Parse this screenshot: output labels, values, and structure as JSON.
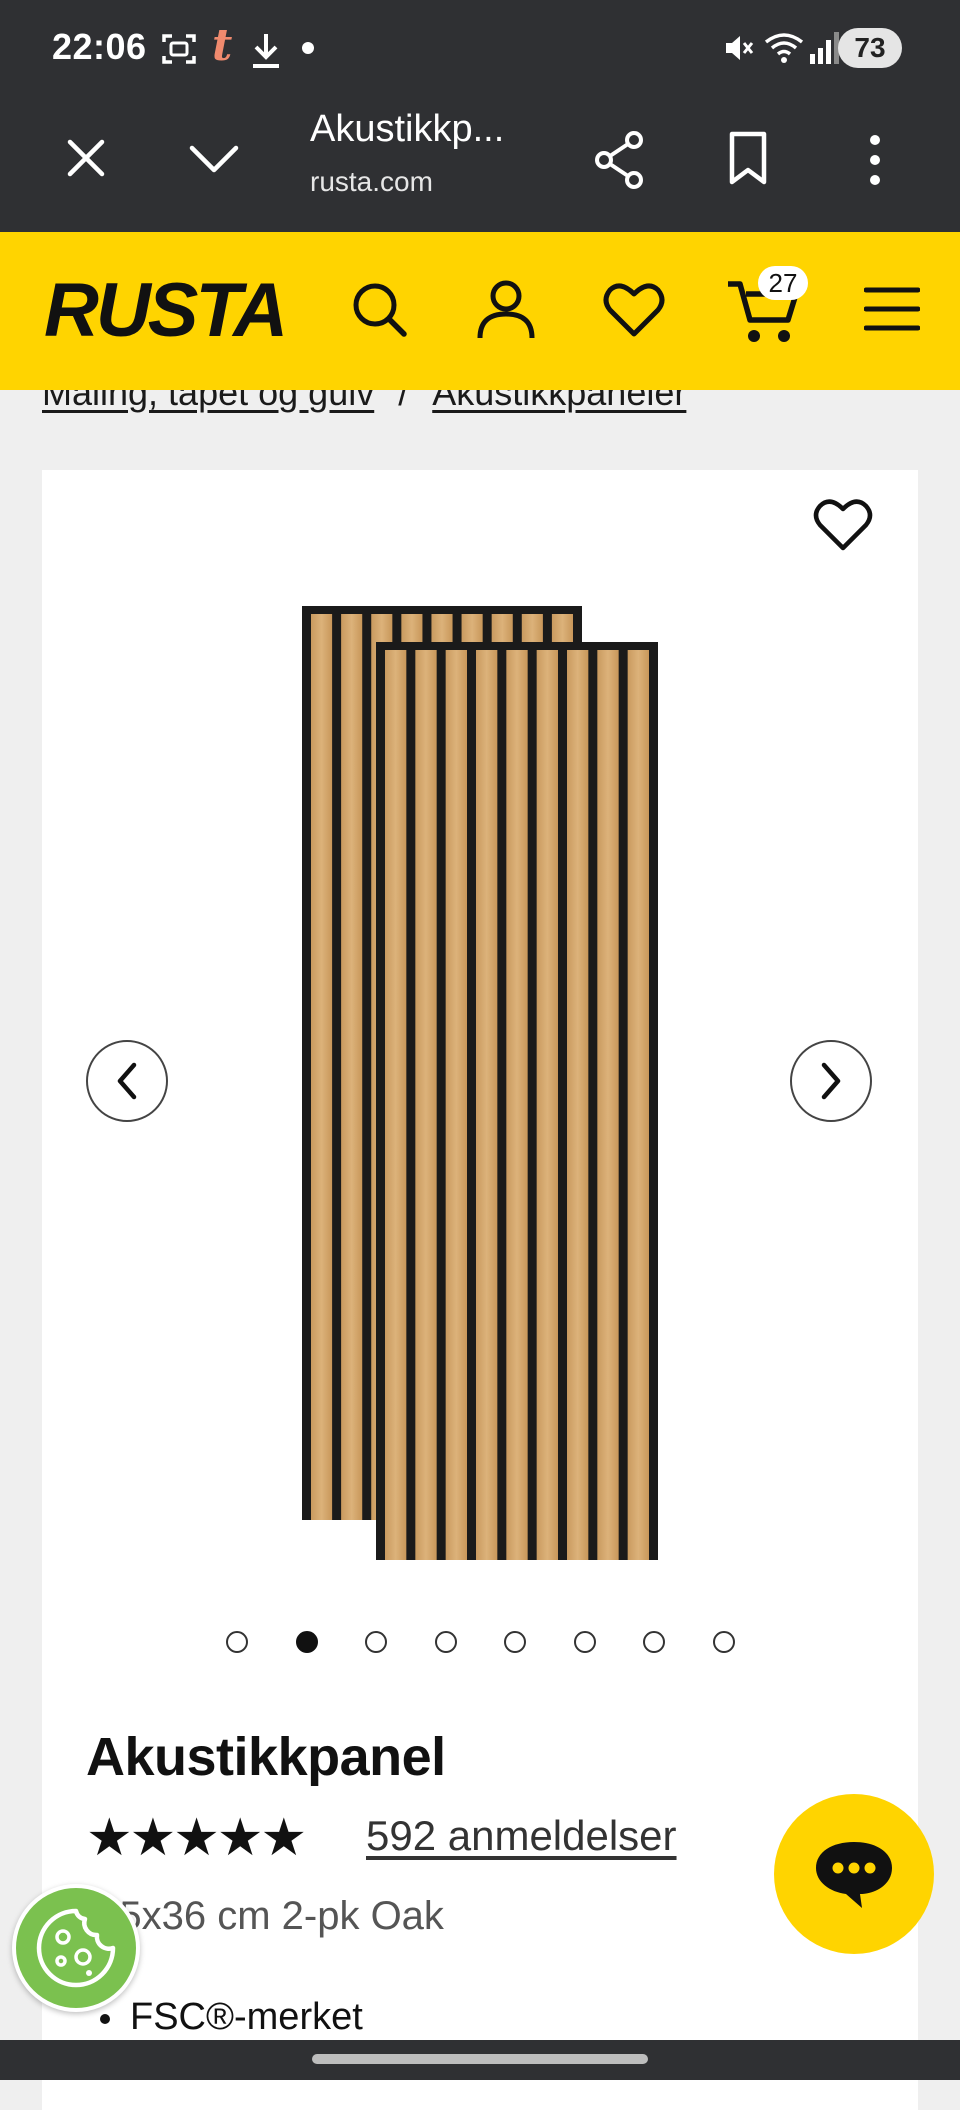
{
  "status_bar": {
    "time": "22:06",
    "battery": "73"
  },
  "browser": {
    "tab_title": "Akustikkp...",
    "url": "rusta.com"
  },
  "site": {
    "brand": "RUSTA",
    "cart_count": "27",
    "accent": "#ffd400"
  },
  "breadcrumb": {
    "items": [
      "Maling, tapet og gulv",
      "Akustikkpaneler"
    ],
    "separator": "/"
  },
  "gallery": {
    "image_count": 8,
    "active_index": 1
  },
  "product": {
    "title": "Akustikkpanel",
    "rating_stars": "★★★★★",
    "rating": 5,
    "reviews_label": "592 anmeldelser",
    "variant": "7.5x36 cm 2-pk Oak",
    "features": [
      "FSC®-merket"
    ]
  }
}
